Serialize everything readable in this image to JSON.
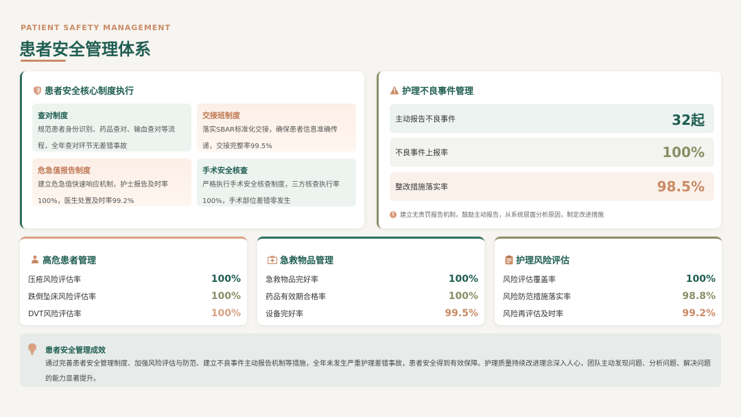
{
  "header": {
    "eyebrow": "PATIENT SAFETY MANAGEMENT",
    "title": "患者安全管理体系"
  },
  "core": {
    "title": "患者安全核心制度执行",
    "icon": "shield-icon",
    "items": [
      {
        "name": "查对制度",
        "desc": "规范患者身份识别、药品查对、输血查对等流程，全年查对环节无差错事故"
      },
      {
        "name": "交接班制度",
        "desc": "落实SBAR标准化交接，确保患者信息准确传递，交接完整率99.5%"
      },
      {
        "name": "危急值报告制度",
        "desc": "建立危急值快速响应机制，护士报告及时率100%，医生处置及时率99.2%"
      },
      {
        "name": "手术安全核查",
        "desc": "严格执行手术安全核查制度，三方核查执行率100%，手术部位差错零发生"
      }
    ]
  },
  "adverse": {
    "title": "护理不良事件管理",
    "icon": "warning-icon",
    "stats": [
      {
        "label": "主动报告不良事件",
        "value": "32起"
      },
      {
        "label": "不良事件上报率",
        "value": "100%"
      },
      {
        "label": "整改措施落实率",
        "value": "98.5%"
      }
    ],
    "note": "建立无责罚报告机制，鼓励主动报告，从系统层面分析原因，制定改进措施"
  },
  "high_risk": {
    "title": "高危患者管理",
    "icon": "patient-icon",
    "metrics": [
      {
        "label": "压疮风险评估率",
        "value": "100%"
      },
      {
        "label": "跌倒坠床风险评估率",
        "value": "100%"
      },
      {
        "label": "DVT风险评估率",
        "value": "100%"
      }
    ]
  },
  "emergency": {
    "title": "急救物品管理",
    "icon": "medkit-icon",
    "metrics": [
      {
        "label": "急救物品完好率",
        "value": "100%"
      },
      {
        "label": "药品有效期合格率",
        "value": "100%"
      },
      {
        "label": "设备完好率",
        "value": "99.5%"
      }
    ]
  },
  "risk_eval": {
    "title": "护理风险评估",
    "icon": "clipboard-icon",
    "metrics": [
      {
        "label": "风险评估覆盖率",
        "value": "100%"
      },
      {
        "label": "风险防范措施落实率",
        "value": "98.8%"
      },
      {
        "label": "风险再评估及时率",
        "value": "99.2%"
      }
    ]
  },
  "summary": {
    "title": "患者安全管理成效",
    "icon": "lightbulb-icon",
    "text": "通过完善患者安全管理制度、加强风险评估与防范、建立不良事件主动报告机制等措施，全年未发生严重护理差错事故，患者安全得到有效保障。护理质量持续改进理念深入人心，团队主动发现问题、分析问题、解决问题的能力显著提升。"
  },
  "colors": {
    "primary": "#1f5e52",
    "accent": "#c98b66",
    "olive": "#8b8e66"
  }
}
